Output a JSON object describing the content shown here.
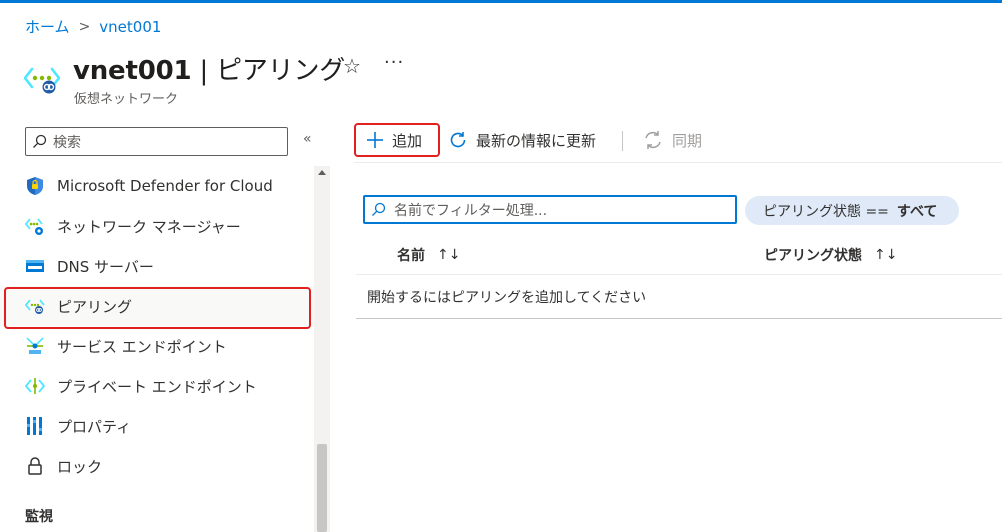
{
  "breadcrumb": {
    "home": "ホーム",
    "separator": ">",
    "current": "vnet001"
  },
  "header": {
    "resource_name": "vnet001",
    "divider": " | ",
    "page": "ピアリング",
    "subtitle": "仮想ネットワーク",
    "favorite_glyph": "☆",
    "more_glyph": "···"
  },
  "sidebar": {
    "search_placeholder": "検索",
    "collapse_glyph": "«",
    "items": [
      {
        "label": "Microsoft Defender for Cloud",
        "icon": "defender-shield-icon"
      },
      {
        "label": "ネットワーク マネージャー",
        "icon": "network-manager-icon"
      },
      {
        "label": "DNS サーバー",
        "icon": "dns-server-icon"
      },
      {
        "label": "ピアリング",
        "icon": "peering-icon",
        "selected": true
      },
      {
        "label": "サービス エンドポイント",
        "icon": "service-endpoint-icon"
      },
      {
        "label": "プライベート エンドポイント",
        "icon": "private-endpoint-icon"
      },
      {
        "label": "プロパティ",
        "icon": "properties-icon"
      },
      {
        "label": "ロック",
        "icon": "lock-icon"
      }
    ],
    "section_label": "監視"
  },
  "toolbar": {
    "add_label": "追加",
    "refresh_label": "最新の情報に更新",
    "sync_label": "同期"
  },
  "filter": {
    "placeholder": "名前でフィルター処理...",
    "pill_key": "ピアリング状態 ==",
    "pill_value": "すべて"
  },
  "table": {
    "columns": [
      "名前",
      "ピアリング状態"
    ],
    "sort_glyph": "↑↓",
    "empty_message": "開始するにはピアリングを追加してください"
  },
  "colors": {
    "accent": "#0078d4",
    "highlight_border": "#e1201f",
    "pill_bg": "#dfe9f7"
  }
}
